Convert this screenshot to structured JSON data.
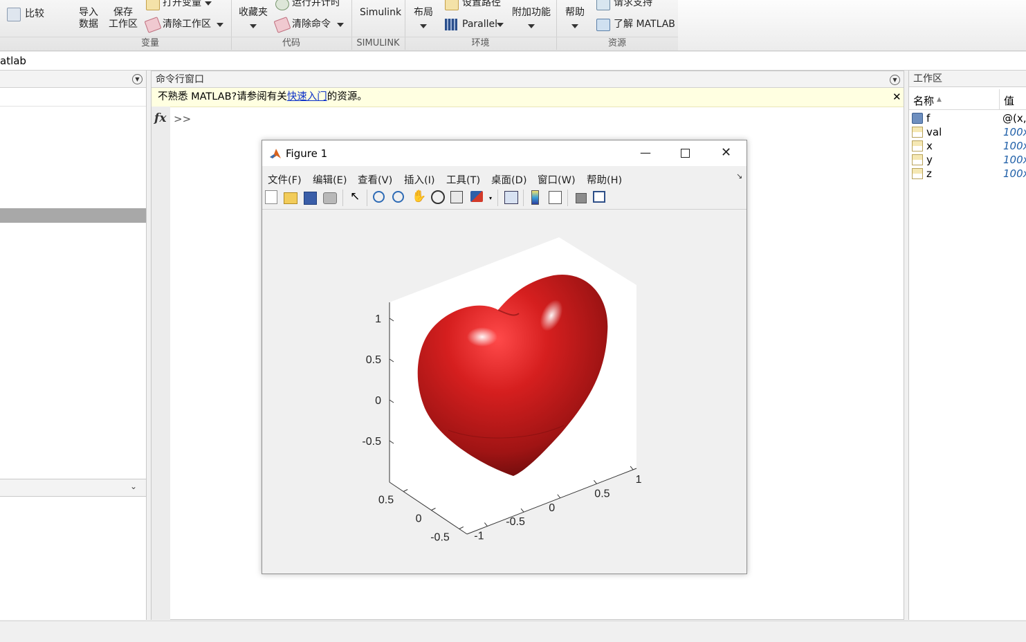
{
  "ribbon": {
    "compare_label": "比较",
    "import_label": [
      "导入",
      "数据"
    ],
    "save_workspace_label": [
      "保存",
      "工作区"
    ],
    "open_variable_label": "打开变量",
    "clear_workspace_label": "清除工作区",
    "favorites_label": "收藏夹",
    "run_and_time_label": "运行并计时",
    "clear_commands_label": "清除命令",
    "simulink_label": "Simulink",
    "layout_label": "布局",
    "set_path_label": "设置路径",
    "parallel_label": "Parallel",
    "addons_label": "附加功能",
    "help_label": "帮助",
    "request_support_label": "请求支持",
    "learn_matlab_label": "了解 MATLAB",
    "groups": {
      "variable": "变量",
      "code": "代码",
      "simulink": "SIMULINK",
      "environment": "环境",
      "resources": "资源"
    }
  },
  "address_bar": {
    "path": "atlab"
  },
  "command_window": {
    "title": "命令行窗口",
    "notice_prefix": "不熟悉 MATLAB?请参阅有关",
    "notice_link": "快速入门",
    "notice_suffix": "的资源。",
    "fx_label": "fx",
    "prompt": ">>"
  },
  "figure": {
    "title": "Figure 1",
    "menu": [
      "文件(F)",
      "编辑(E)",
      "查看(V)",
      "插入(I)",
      "工具(T)",
      "桌面(D)",
      "窗口(W)",
      "帮助(H)"
    ],
    "toolbar_icons": [
      "new-figure-icon",
      "open-file-icon",
      "save-icon",
      "print-icon",
      "edit-plot-icon",
      "zoom-in-icon",
      "zoom-out-icon",
      "pan-icon",
      "rotate-3d-icon",
      "data-cursor-icon",
      "brush-icon",
      "link-plot-icon",
      "colorbar-icon",
      "legend-icon",
      "hide-plot-tools-icon",
      "show-plot-tools-icon"
    ],
    "surface_color": "#c01a1a"
  },
  "chart_data": {
    "type": "surface",
    "title": "",
    "zlim": [
      -1,
      1.2
    ],
    "xlim": [
      -1,
      1
    ],
    "ylim": [
      -0.5,
      0.5
    ],
    "z_ticks": [
      "1",
      "0.5",
      "0",
      "-0.5"
    ],
    "x_ticks": [
      "-1",
      "-0.5",
      "0",
      "0.5",
      "1"
    ],
    "y_ticks": [
      "0.5",
      "0",
      "-0.5"
    ],
    "grid": false
  },
  "workspace": {
    "title": "工作区",
    "col_name": "名称",
    "col_value": "值",
    "vars": [
      {
        "name": "f",
        "value": "@(x,y"
      },
      {
        "name": "val",
        "value": "100x"
      },
      {
        "name": "x",
        "value": "100x"
      },
      {
        "name": "y",
        "value": "100x"
      },
      {
        "name": "z",
        "value": "100x"
      }
    ]
  }
}
